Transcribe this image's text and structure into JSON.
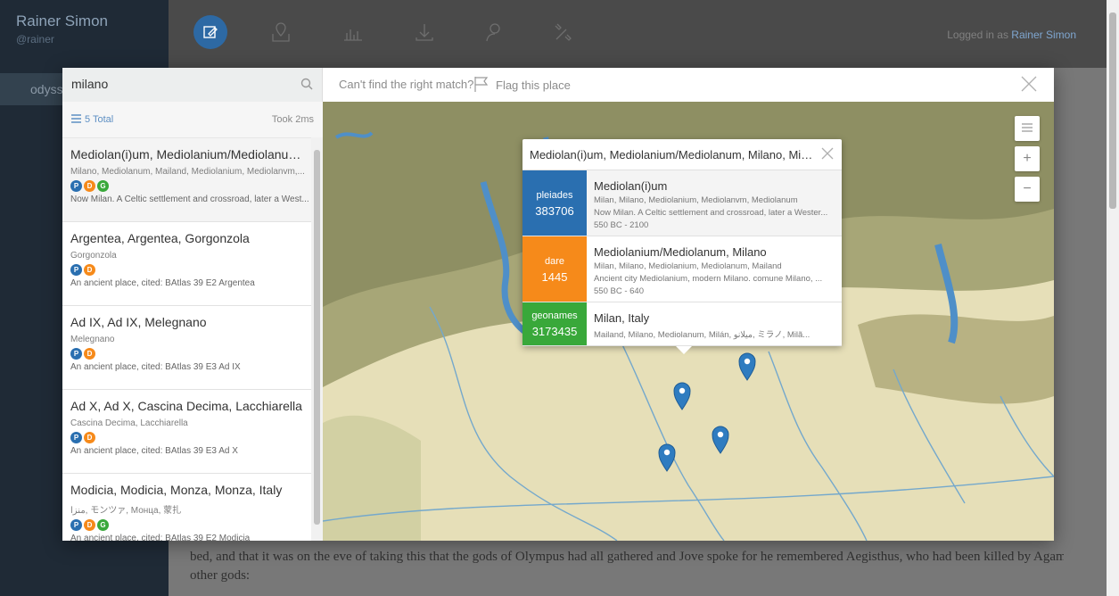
{
  "app": {
    "user_name": "Rainer Simon",
    "user_handle": "@rainer",
    "doc_item": "odyssey",
    "logged_prefix": "Logged in as",
    "logged_user": "Rainer Simon",
    "bg_text_line1": "other gods:",
    "bg_text_line0": "bed, and that it was on the eve of taking this that the gods of Olympus had all gathered and Jove spoke for he remembered Aegisthus, who had been killed by Agamemnon's son Orestes; so he said to the"
  },
  "modal": {
    "search_value": "milano",
    "cant_find": "Can't find the right match?",
    "flag_label": "Flag this place",
    "total": "5 Total",
    "took": "Took 2ms"
  },
  "results": [
    {
      "title": "Mediolan(i)um, Mediolanium/Mediolanum, Mila...",
      "names": "Milano, Mediolanum, Mailand, Mediolanium, Mediolanvm,...",
      "badges": [
        "P",
        "D",
        "G"
      ],
      "desc": "Now Milan. A Celtic settlement and crossroad, later a West..."
    },
    {
      "title": "Argentea, Argentea, Gorgonzola",
      "names": "Gorgonzola",
      "badges": [
        "P",
        "D"
      ],
      "desc": "An ancient place, cited: BAtlas 39 E2 Argentea"
    },
    {
      "title": "Ad IX, Ad IX, Melegnano",
      "names": "Melegnano",
      "badges": [
        "P",
        "D"
      ],
      "desc": "An ancient place, cited: BAtlas 39 E3 Ad IX"
    },
    {
      "title": "Ad X, Ad X, Cascina Decima, Lacchiarella",
      "names": "Cascina Decima, Lacchiarella",
      "badges": [
        "P",
        "D"
      ],
      "desc": "An ancient place, cited: BAtlas 39 E3 Ad X"
    },
    {
      "title": "Modicia, Modicia, Monza, Monza, Italy",
      "names": "منزا, モンツァ, Монца, 蒙扎",
      "badges": [
        "P",
        "D",
        "G"
      ],
      "desc": "An ancient place, cited: BAtlas 39 E2 Modicia"
    }
  ],
  "popup": {
    "title": "Mediolan(i)um, Mediolanium/Mediolanum, Milano, Milan, I...",
    "rows": [
      {
        "gazetteer": "pleiades",
        "id": "383706",
        "color": "#2a6fb0",
        "title": "Mediolan(i)um",
        "names": "Milan, Milano, Mediolanium, Mediolanvm, Mediolanum",
        "desc": "Now Milan. A Celtic settlement and crossroad, later a Wester...",
        "dates": "550 BC - 2100"
      },
      {
        "gazetteer": "dare",
        "id": "1445",
        "color": "#f68a1a",
        "title": "Mediolanium/Mediolanum, Milano",
        "names": "Milan, Milano, Mediolanium, Mediolanum, Mailand",
        "desc": "Ancient city Mediolanium, modern Milano. comune Milano, ...",
        "dates": "550 BC - 640"
      },
      {
        "gazetteer": "geonames",
        "id": "3173435",
        "color": "#39a83a",
        "title": "Milan, Italy",
        "names": "Mailand, Milano, Mediolanum, Milán, میلانو, ミラノ, Milã...",
        "desc": "",
        "dates": ""
      }
    ]
  },
  "colors": {
    "accent": "#2d69a4",
    "pleiades": "#2a6fb0",
    "dare": "#f68a1a",
    "geonames": "#39a83a"
  }
}
